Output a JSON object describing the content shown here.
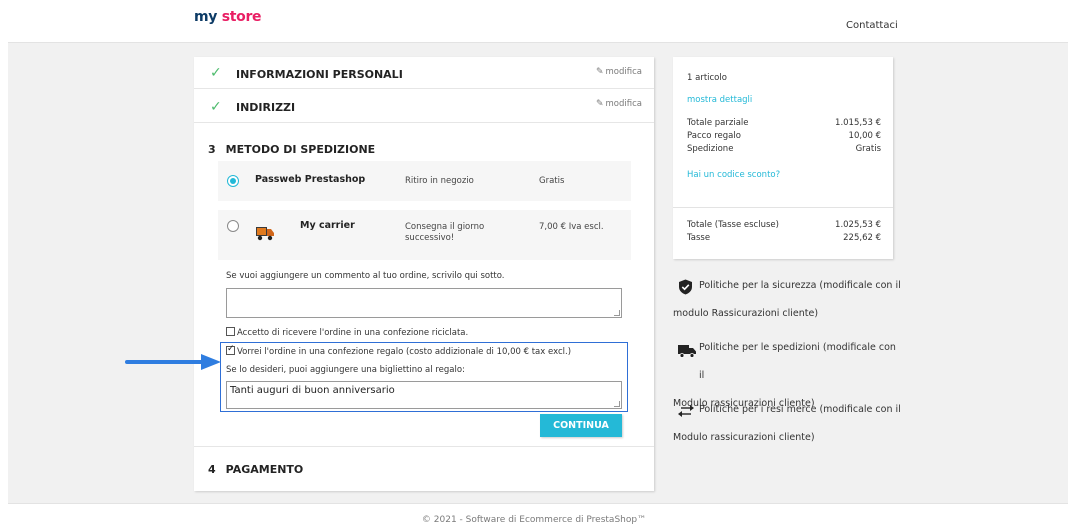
{
  "header": {
    "logo_part1": "my",
    "logo_part2": "store",
    "contact_link": "Contattaci"
  },
  "checkout": {
    "step1": {
      "title": "INFORMAZIONI PERSONALI",
      "edit_label": "modifica"
    },
    "step2": {
      "title": "INDIRIZZI",
      "edit_label": "modifica"
    },
    "step3": {
      "number": "3",
      "title": "METODO DI SPEDIZIONE",
      "carriers": [
        {
          "name": "Passweb Prestashop",
          "delay": "Ritiro in negozio",
          "price": "Gratis",
          "selected": true
        },
        {
          "name": "My carrier",
          "delay": "Consegna il giorno successivo!",
          "price": "7,00 € Iva escl.",
          "selected": false
        }
      ],
      "comment_label": "Se vuoi aggiungere un commento al tuo ordine, scrivilo qui sotto.",
      "comment_value": "",
      "recycled_label": "Accetto di ricevere l'ordine in una confezione riciclata.",
      "recycled_checked": false,
      "gift_label": "Vorrei l'ordine in una confezione regalo (costo addizionale di 10,00 € tax excl.)",
      "gift_checked": true,
      "gift_message_label": "Se lo desideri, puoi aggiungere una bigliettino al regalo:",
      "gift_message_value": "Tanti auguri di buon anniversario",
      "continue_label": "CONTINUA"
    },
    "step4": {
      "number": "4",
      "title": "PAGAMENTO"
    }
  },
  "summary": {
    "items_count": "1 articolo",
    "show_details": "mostra dettagli",
    "rows": [
      {
        "label": "Totale parziale",
        "value": "1.015,53 €"
      },
      {
        "label": "Pacco regalo",
        "value": "10,00 €"
      },
      {
        "label": "Spedizione",
        "value": "Gratis"
      }
    ],
    "discount_link": "Hai un codice sconto?",
    "total_label": "Totale (Tasse escluse)",
    "total_value": "1.025,53 €",
    "taxes_label": "Tasse",
    "taxes_value": "225,62 €"
  },
  "reassurance": [
    {
      "icon": "shield-check-icon",
      "line1": "Politiche per la sicurezza (modificale con il",
      "line2": "modulo Rassicurazioni cliente)"
    },
    {
      "icon": "truck-icon",
      "line1": "Politiche per le spedizioni (modificale con il",
      "line2": "Modulo rassicurazioni cliente)"
    },
    {
      "icon": "exchange-arrows-icon",
      "line1": "Politiche per i resi merce (modificale con il",
      "line2": "Modulo rassicurazioni cliente)"
    }
  ],
  "footer": {
    "text": "© 2021 - Software di Ecommerce di PrestaShop™"
  },
  "colors": {
    "accent": "#24b9d7",
    "check_green": "#4cbb6c",
    "highlight_blue": "#2f6fd6",
    "logo_navy": "#0d3b66",
    "logo_pink": "#e91e63"
  }
}
